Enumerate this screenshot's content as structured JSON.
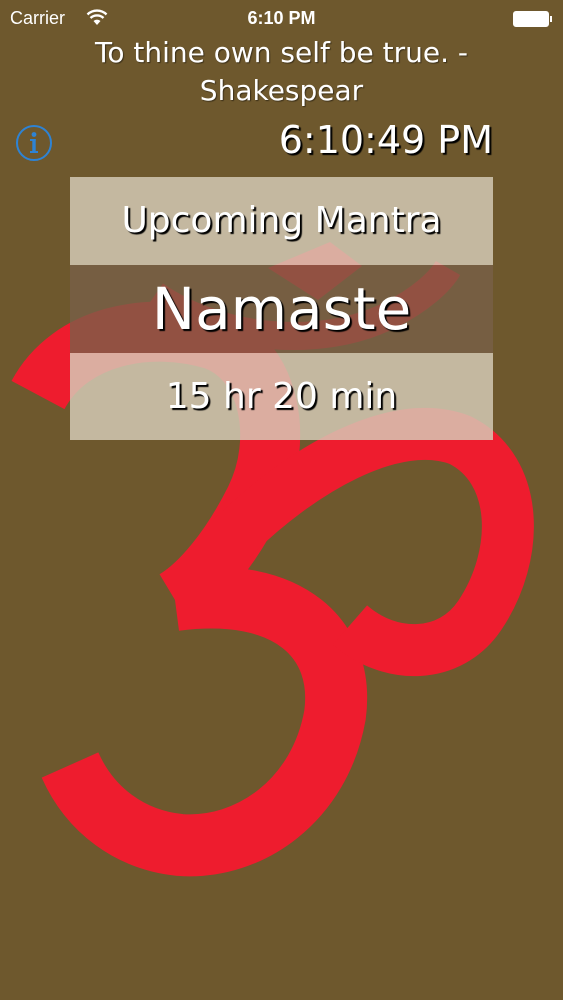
{
  "status_bar": {
    "carrier": "Carrier",
    "time": "6:10 PM"
  },
  "quote": {
    "line1": "To thine own self be true. -",
    "line2": "Shakespear"
  },
  "clock": "6:10:49 PM",
  "mantra_card": {
    "header": "Upcoming Mantra",
    "name": "Namaste",
    "countdown": "15 hr 20 min"
  },
  "colors": {
    "background": "#6e582d",
    "om_symbol": "#ee1c2e",
    "info_icon": "#2e83d4"
  },
  "icons": {
    "info": "info-icon",
    "wifi": "wifi-icon",
    "battery": "battery-icon",
    "background": "om-symbol-icon"
  }
}
